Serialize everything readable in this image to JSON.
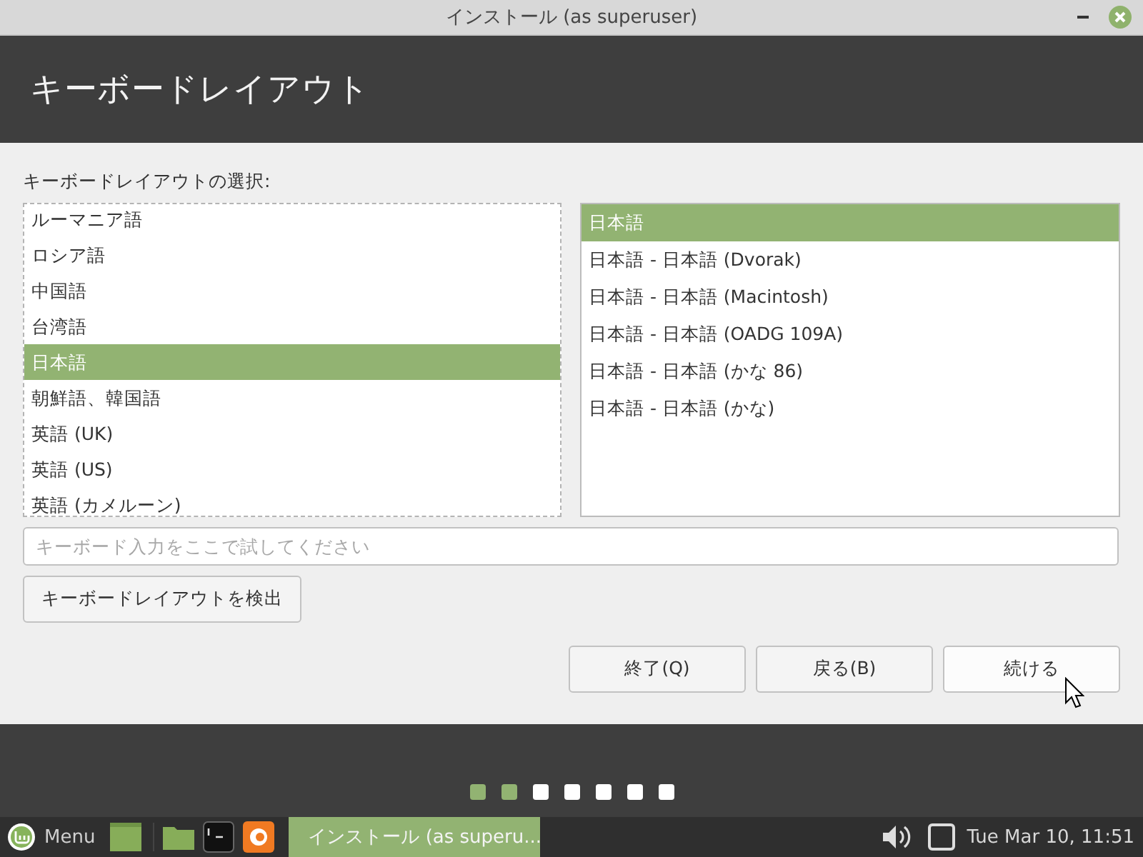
{
  "window": {
    "title": "インストール (as superuser)"
  },
  "header": {
    "title": "キーボードレイアウト"
  },
  "layout_label": "キーボードレイアウトの選択:",
  "layouts": [
    {
      "label": "ルーマニア語",
      "selected": false
    },
    {
      "label": "ロシア語",
      "selected": false
    },
    {
      "label": "中国語",
      "selected": false
    },
    {
      "label": "台湾語",
      "selected": false
    },
    {
      "label": "日本語",
      "selected": true
    },
    {
      "label": "朝鮮語、韓国語",
      "selected": false
    },
    {
      "label": "英語 (UK)",
      "selected": false
    },
    {
      "label": "英語 (US)",
      "selected": false
    },
    {
      "label": "英語 (カメルーン)",
      "selected": false
    }
  ],
  "variants": [
    {
      "label": "日本語",
      "selected": true
    },
    {
      "label": "日本語 - 日本語 (Dvorak)",
      "selected": false
    },
    {
      "label": "日本語 - 日本語 (Macintosh)",
      "selected": false
    },
    {
      "label": "日本語 - 日本語 (OADG 109A)",
      "selected": false
    },
    {
      "label": "日本語 - 日本語 (かな 86)",
      "selected": false
    },
    {
      "label": "日本語 - 日本語 (かな)",
      "selected": false
    }
  ],
  "test_field": {
    "placeholder": "キーボード入力をここで試してください"
  },
  "detect_button": "キーボードレイアウトを検出",
  "buttons": [
    "終了(Q)",
    "戻る(B)",
    "続ける"
  ],
  "steps": [
    {
      "done": true
    },
    {
      "done": true
    },
    {
      "done": false
    },
    {
      "done": false
    },
    {
      "done": false
    },
    {
      "done": false
    },
    {
      "done": false
    }
  ],
  "taskbar": {
    "menu": "Menu",
    "window_button": "インストール (as superu...",
    "clock": "Tue Mar 10, 11:51"
  }
}
